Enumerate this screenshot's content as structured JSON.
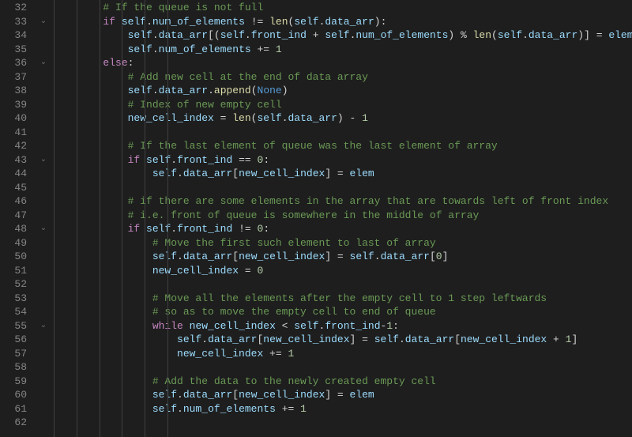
{
  "editor": {
    "first_line_number": 32,
    "fold_markers": {
      "33": true,
      "36": true,
      "43": true,
      "48": true,
      "55": true
    },
    "indent_guide_columns": [
      0,
      4,
      8,
      12,
      16,
      20
    ],
    "lines": [
      {
        "indent": 8,
        "tokens": [
          {
            "t": "comment",
            "v": "# If the queue is not full"
          }
        ]
      },
      {
        "indent": 8,
        "tokens": [
          {
            "t": "keyword",
            "v": "if"
          },
          {
            "t": "op",
            "v": " "
          },
          {
            "t": "self",
            "v": "self"
          },
          {
            "t": "op",
            "v": "."
          },
          {
            "t": "prop",
            "v": "num_of_elements"
          },
          {
            "t": "op",
            "v": " != "
          },
          {
            "t": "func",
            "v": "len"
          },
          {
            "t": "op",
            "v": "("
          },
          {
            "t": "self",
            "v": "self"
          },
          {
            "t": "op",
            "v": "."
          },
          {
            "t": "prop",
            "v": "data_arr"
          },
          {
            "t": "op",
            "v": "):"
          }
        ]
      },
      {
        "indent": 12,
        "tokens": [
          {
            "t": "self",
            "v": "self"
          },
          {
            "t": "op",
            "v": "."
          },
          {
            "t": "prop",
            "v": "data_arr"
          },
          {
            "t": "op",
            "v": "[("
          },
          {
            "t": "self",
            "v": "self"
          },
          {
            "t": "op",
            "v": "."
          },
          {
            "t": "prop",
            "v": "front_ind"
          },
          {
            "t": "op",
            "v": " + "
          },
          {
            "t": "self",
            "v": "self"
          },
          {
            "t": "op",
            "v": "."
          },
          {
            "t": "prop",
            "v": "num_of_elements"
          },
          {
            "t": "op",
            "v": ") % "
          },
          {
            "t": "func",
            "v": "len"
          },
          {
            "t": "op",
            "v": "("
          },
          {
            "t": "self",
            "v": "self"
          },
          {
            "t": "op",
            "v": "."
          },
          {
            "t": "prop",
            "v": "data_arr"
          },
          {
            "t": "op",
            "v": ")] = "
          },
          {
            "t": "var",
            "v": "elem"
          }
        ]
      },
      {
        "indent": 12,
        "tokens": [
          {
            "t": "self",
            "v": "self"
          },
          {
            "t": "op",
            "v": "."
          },
          {
            "t": "prop",
            "v": "num_of_elements"
          },
          {
            "t": "op",
            "v": " += "
          },
          {
            "t": "num",
            "v": "1"
          }
        ]
      },
      {
        "indent": 8,
        "tokens": [
          {
            "t": "keyword",
            "v": "else"
          },
          {
            "t": "op",
            "v": ":"
          }
        ]
      },
      {
        "indent": 12,
        "tokens": [
          {
            "t": "comment",
            "v": "# Add new cell at the end of data array"
          }
        ]
      },
      {
        "indent": 12,
        "tokens": [
          {
            "t": "self",
            "v": "self"
          },
          {
            "t": "op",
            "v": "."
          },
          {
            "t": "prop",
            "v": "data_arr"
          },
          {
            "t": "op",
            "v": "."
          },
          {
            "t": "func",
            "v": "append"
          },
          {
            "t": "op",
            "v": "("
          },
          {
            "t": "const",
            "v": "None"
          },
          {
            "t": "op",
            "v": ")"
          }
        ]
      },
      {
        "indent": 12,
        "tokens": [
          {
            "t": "comment",
            "v": "# Index of new empty cell"
          }
        ]
      },
      {
        "indent": 12,
        "tokens": [
          {
            "t": "var",
            "v": "new_cell_index"
          },
          {
            "t": "op",
            "v": " = "
          },
          {
            "t": "func",
            "v": "len"
          },
          {
            "t": "op",
            "v": "("
          },
          {
            "t": "self",
            "v": "self"
          },
          {
            "t": "op",
            "v": "."
          },
          {
            "t": "prop",
            "v": "data_arr"
          },
          {
            "t": "op",
            "v": ") - "
          },
          {
            "t": "num",
            "v": "1"
          }
        ]
      },
      {
        "indent": 0,
        "tokens": []
      },
      {
        "indent": 12,
        "tokens": [
          {
            "t": "comment",
            "v": "# If the last element of queue was the last element of array"
          }
        ]
      },
      {
        "indent": 12,
        "tokens": [
          {
            "t": "keyword",
            "v": "if"
          },
          {
            "t": "op",
            "v": " "
          },
          {
            "t": "self",
            "v": "self"
          },
          {
            "t": "op",
            "v": "."
          },
          {
            "t": "prop",
            "v": "front_ind"
          },
          {
            "t": "op",
            "v": " == "
          },
          {
            "t": "num",
            "v": "0"
          },
          {
            "t": "op",
            "v": ":"
          }
        ]
      },
      {
        "indent": 16,
        "tokens": [
          {
            "t": "self",
            "v": "self"
          },
          {
            "t": "op",
            "v": "."
          },
          {
            "t": "prop",
            "v": "data_arr"
          },
          {
            "t": "op",
            "v": "["
          },
          {
            "t": "var",
            "v": "new_cell_index"
          },
          {
            "t": "op",
            "v": "] = "
          },
          {
            "t": "var",
            "v": "elem"
          }
        ]
      },
      {
        "indent": 0,
        "tokens": []
      },
      {
        "indent": 12,
        "tokens": [
          {
            "t": "comment",
            "v": "# if there are some elements in the array that are towards left of front index"
          }
        ]
      },
      {
        "indent": 12,
        "tokens": [
          {
            "t": "comment",
            "v": "# i.e. front of queue is somewhere in the middle of array"
          }
        ]
      },
      {
        "indent": 12,
        "tokens": [
          {
            "t": "keyword",
            "v": "if"
          },
          {
            "t": "op",
            "v": " "
          },
          {
            "t": "self",
            "v": "self"
          },
          {
            "t": "op",
            "v": "."
          },
          {
            "t": "prop",
            "v": "front_ind"
          },
          {
            "t": "op",
            "v": " != "
          },
          {
            "t": "num",
            "v": "0"
          },
          {
            "t": "op",
            "v": ":"
          }
        ]
      },
      {
        "indent": 16,
        "tokens": [
          {
            "t": "comment",
            "v": "# Move the first such element to last of array"
          }
        ]
      },
      {
        "indent": 16,
        "tokens": [
          {
            "t": "self",
            "v": "self"
          },
          {
            "t": "op",
            "v": "."
          },
          {
            "t": "prop",
            "v": "data_arr"
          },
          {
            "t": "op",
            "v": "["
          },
          {
            "t": "var",
            "v": "new_cell_index"
          },
          {
            "t": "op",
            "v": "] = "
          },
          {
            "t": "self",
            "v": "self"
          },
          {
            "t": "op",
            "v": "."
          },
          {
            "t": "prop",
            "v": "data_arr"
          },
          {
            "t": "op",
            "v": "["
          },
          {
            "t": "num",
            "v": "0"
          },
          {
            "t": "op",
            "v": "]"
          }
        ]
      },
      {
        "indent": 16,
        "tokens": [
          {
            "t": "var",
            "v": "new_cell_index"
          },
          {
            "t": "op",
            "v": " = "
          },
          {
            "t": "num",
            "v": "0"
          }
        ]
      },
      {
        "indent": 0,
        "tokens": []
      },
      {
        "indent": 16,
        "tokens": [
          {
            "t": "comment",
            "v": "# Move all the elements after the empty cell to 1 step leftwards"
          }
        ]
      },
      {
        "indent": 16,
        "tokens": [
          {
            "t": "comment",
            "v": "# so as to move the empty cell to end of queue"
          }
        ]
      },
      {
        "indent": 16,
        "tokens": [
          {
            "t": "keyword",
            "v": "while"
          },
          {
            "t": "op",
            "v": " "
          },
          {
            "t": "var",
            "v": "new_cell_index"
          },
          {
            "t": "op",
            "v": " < "
          },
          {
            "t": "self",
            "v": "self"
          },
          {
            "t": "op",
            "v": "."
          },
          {
            "t": "prop",
            "v": "front_ind"
          },
          {
            "t": "op",
            "v": "-"
          },
          {
            "t": "num",
            "v": "1"
          },
          {
            "t": "op",
            "v": ":"
          }
        ]
      },
      {
        "indent": 20,
        "tokens": [
          {
            "t": "self",
            "v": "self"
          },
          {
            "t": "op",
            "v": "."
          },
          {
            "t": "prop",
            "v": "data_arr"
          },
          {
            "t": "op",
            "v": "["
          },
          {
            "t": "var",
            "v": "new_cell_index"
          },
          {
            "t": "op",
            "v": "] = "
          },
          {
            "t": "self",
            "v": "self"
          },
          {
            "t": "op",
            "v": "."
          },
          {
            "t": "prop",
            "v": "data_arr"
          },
          {
            "t": "op",
            "v": "["
          },
          {
            "t": "var",
            "v": "new_cell_index"
          },
          {
            "t": "op",
            "v": " + "
          },
          {
            "t": "num",
            "v": "1"
          },
          {
            "t": "op",
            "v": "]"
          }
        ]
      },
      {
        "indent": 20,
        "tokens": [
          {
            "t": "var",
            "v": "new_cell_index"
          },
          {
            "t": "op",
            "v": " += "
          },
          {
            "t": "num",
            "v": "1"
          }
        ]
      },
      {
        "indent": 0,
        "tokens": []
      },
      {
        "indent": 16,
        "tokens": [
          {
            "t": "comment",
            "v": "# Add the data to the newly created empty cell"
          }
        ]
      },
      {
        "indent": 16,
        "tokens": [
          {
            "t": "self",
            "v": "self"
          },
          {
            "t": "op",
            "v": "."
          },
          {
            "t": "prop",
            "v": "data_arr"
          },
          {
            "t": "op",
            "v": "["
          },
          {
            "t": "var",
            "v": "new_cell_index"
          },
          {
            "t": "op",
            "v": "] = "
          },
          {
            "t": "var",
            "v": "elem"
          }
        ]
      },
      {
        "indent": 16,
        "tokens": [
          {
            "t": "self",
            "v": "self"
          },
          {
            "t": "op",
            "v": "."
          },
          {
            "t": "prop",
            "v": "num_of_elements"
          },
          {
            "t": "op",
            "v": " += "
          },
          {
            "t": "num",
            "v": "1"
          }
        ]
      },
      {
        "indent": 0,
        "tokens": []
      }
    ]
  }
}
